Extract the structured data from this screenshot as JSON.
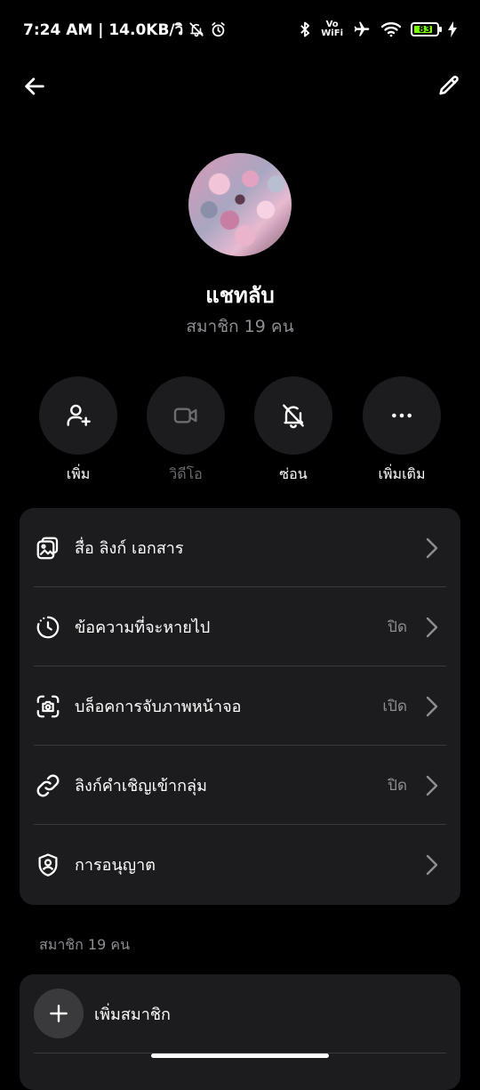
{
  "status_bar": {
    "time_info": "7:24 AM | 14.0KB/วิ",
    "vowifi_top": "Vo",
    "vowifi_bottom": "WiFi",
    "battery_level": "83",
    "battery_fraction": 0.83
  },
  "group": {
    "name": "แชทลับ",
    "member_count": "สมาชิก 19 คน"
  },
  "actions": [
    {
      "label": "เพิ่ม",
      "icon": "add-person-icon",
      "enabled": true
    },
    {
      "label": "วิดีโอ",
      "icon": "video-icon",
      "enabled": false
    },
    {
      "label": "ซ่อน",
      "icon": "mute-bell-icon",
      "enabled": true
    },
    {
      "label": "เพิ่มเติม",
      "icon": "more-icon",
      "enabled": true
    }
  ],
  "settings": [
    {
      "label": "สื่อ ลิงก์ เอกสาร",
      "value": "",
      "icon": "media-icon"
    },
    {
      "label": "ข้อความที่จะหายไป",
      "value": "ปิด",
      "icon": "timer-icon"
    },
    {
      "label": "บล็อคการจับภาพหน้าจอ",
      "value": "เปิด",
      "icon": "screenshot-icon"
    },
    {
      "label": "ลิงก์คำเชิญเข้ากลุ่ม",
      "value": "ปิด",
      "icon": "link-icon"
    },
    {
      "label": "การอนุญาต",
      "value": "",
      "icon": "shield-icon"
    }
  ],
  "members": {
    "header": "สมาชิก 19 คน",
    "add_label": "เพิ่มสมาชิก"
  },
  "colors": {
    "background": "#000000",
    "card": "#1c1c1e",
    "secondary_text": "#8e8e93",
    "battery_fill": "#7CFC00"
  }
}
